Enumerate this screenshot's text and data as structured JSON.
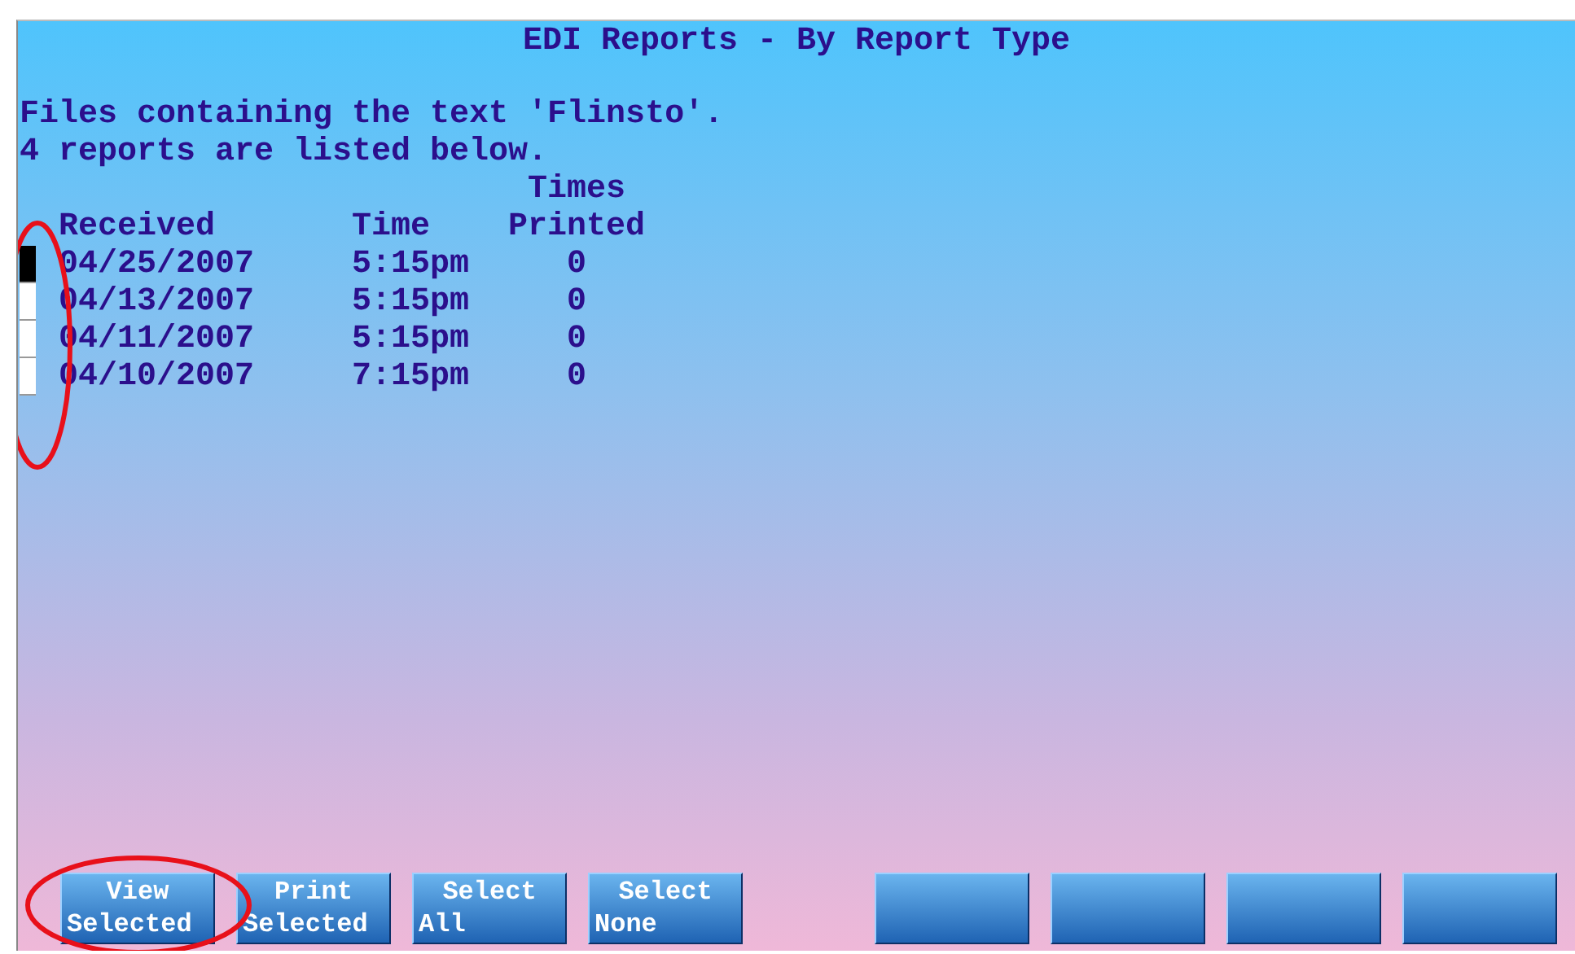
{
  "title": "EDI Reports - By Report Type",
  "messages": [
    "Files containing the text 'Flinsto'.",
    "4 reports are listed below."
  ],
  "table": {
    "columns": [
      {
        "lines": [
          "Received"
        ]
      },
      {
        "lines": [
          "Time"
        ]
      },
      {
        "lines": [
          "Times",
          "Printed"
        ]
      }
    ],
    "rows": [
      {
        "selected": true,
        "cells": [
          "04/25/2007",
          "5:15pm",
          "0"
        ]
      },
      {
        "selected": false,
        "cells": [
          "04/13/2007",
          "5:15pm",
          "0"
        ]
      },
      {
        "selected": false,
        "cells": [
          "04/11/2007",
          "5:15pm",
          "0"
        ]
      },
      {
        "selected": false,
        "cells": [
          "04/10/2007",
          "7:15pm",
          "0"
        ]
      }
    ]
  },
  "buttons": [
    {
      "kind": "labeled",
      "lines": [
        "View",
        "Selected"
      ]
    },
    {
      "kind": "labeled",
      "lines": [
        "Print",
        "Selected"
      ]
    },
    {
      "kind": "labeled",
      "lines": [
        "Select",
        "All"
      ]
    },
    {
      "kind": "labeled",
      "lines": [
        "Select",
        "None"
      ]
    },
    {
      "kind": "spacer"
    },
    {
      "kind": "blank"
    },
    {
      "kind": "blank"
    },
    {
      "kind": "blank"
    },
    {
      "kind": "blank"
    }
  ],
  "annotations": [
    {
      "kind": "ellipse"
    },
    {
      "kind": "ellipse"
    }
  ]
}
